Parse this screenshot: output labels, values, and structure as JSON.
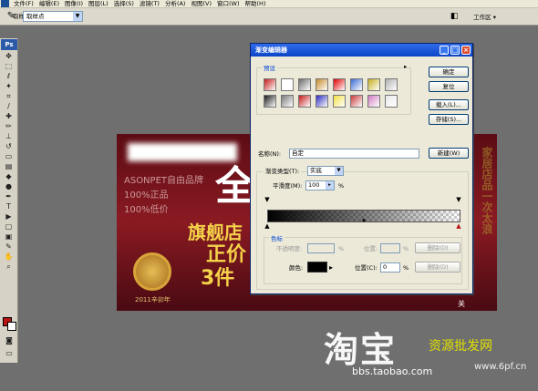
{
  "menubar": {
    "items": [
      "文件(F)",
      "编辑(E)",
      "图像(I)",
      "图层(L)",
      "选择(S)",
      "滤镜(T)",
      "分析(A)",
      "视图(V)",
      "窗口(W)",
      "帮助(H)"
    ]
  },
  "options": {
    "sample_label": "取样大小:",
    "sample_value": "取样点",
    "workspace": "工作区 ▾"
  },
  "toolbox": {
    "logo": "Ps",
    "fg_color": "#b81414",
    "bg_color": "#ffffff"
  },
  "canvas": {
    "bullets": [
      "ASONPET自由品牌",
      "100%正品",
      "100%低价"
    ],
    "big_white": "全",
    "line1": "旗舰店",
    "line2": "正价",
    "line3": "3件",
    "year": "2011辛卯年",
    "vertical_text": "家居店品一次太浪",
    "small_corner": "关"
  },
  "watermarks": {
    "taobao": "淘宝",
    "taobao_url": "bbs.taobao.com",
    "resource": "资源批发网",
    "resource_url": "www.6pf.cn"
  },
  "dialog": {
    "title": "渐变编辑器",
    "presets_label": "预设",
    "buttons": {
      "ok": "确定",
      "reset": "复位",
      "load": "载入(L)...",
      "save": "存储(S)...",
      "new": "新建(W)"
    },
    "name_label": "名称(N):",
    "name_value": "自定",
    "gradient_type_label": "渐变类型(T):",
    "gradient_type_value": "实底",
    "smoothness_label": "平滑度(M):",
    "smoothness_value": "100",
    "smoothness_unit": "%",
    "stops_group": "色标",
    "opacity_label": "不透明度:",
    "opacity_unit": "%",
    "location_label1": "位置:",
    "location_unit1": "%",
    "delete_btn1": "删除(D)",
    "color_label": "颜色:",
    "location_label2": "位置(C):",
    "location_value2": "0",
    "location_unit2": "%",
    "delete_btn2": "删除(D)",
    "preset_colors": [
      "#c41c1c",
      "#ffffff",
      "#6a6a6a",
      "#c78a2a",
      "#e00000",
      "#3a6ad4",
      "#c8b020",
      "#b0b0b0",
      "#1a1a1a",
      "#7a7a7a",
      "#c41c1c",
      "#2c2cc0",
      "#f0e040",
      "#c83c3c",
      "#d07cc0",
      "#e8e8e8"
    ]
  }
}
